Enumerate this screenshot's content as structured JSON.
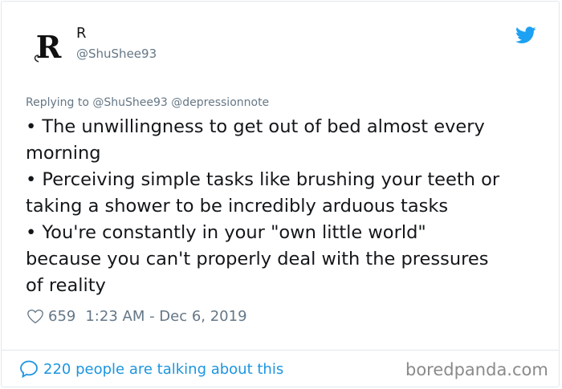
{
  "author": {
    "avatar_letter": "R",
    "name": "R",
    "handle": "@ShuShee93"
  },
  "icons": {
    "brand": "twitter-bird-icon",
    "like": "heart-icon",
    "conversation": "speech-bubble-icon"
  },
  "tweet": {
    "replying_to": "Replying to @ShuShee93 @depressionnote",
    "lines": [
      "• The unwillingness to get out of bed almost every",
      "morning",
      "• Perceiving simple tasks like brushing your teeth or",
      "taking a shower to be incredibly arduous tasks",
      "• You're constantly in your \"own little world\"",
      "because you can't properly deal with the pressures",
      "of reality"
    ],
    "likes": "659",
    "timestamp": "1:23 AM - Dec 6, 2019",
    "talking": "220 people are talking about this"
  },
  "watermark": "boredpanda.com",
  "colors": {
    "twitter_blue": "#1da1f2",
    "link_blue": "#1b95e0",
    "muted_gray": "#657786"
  }
}
